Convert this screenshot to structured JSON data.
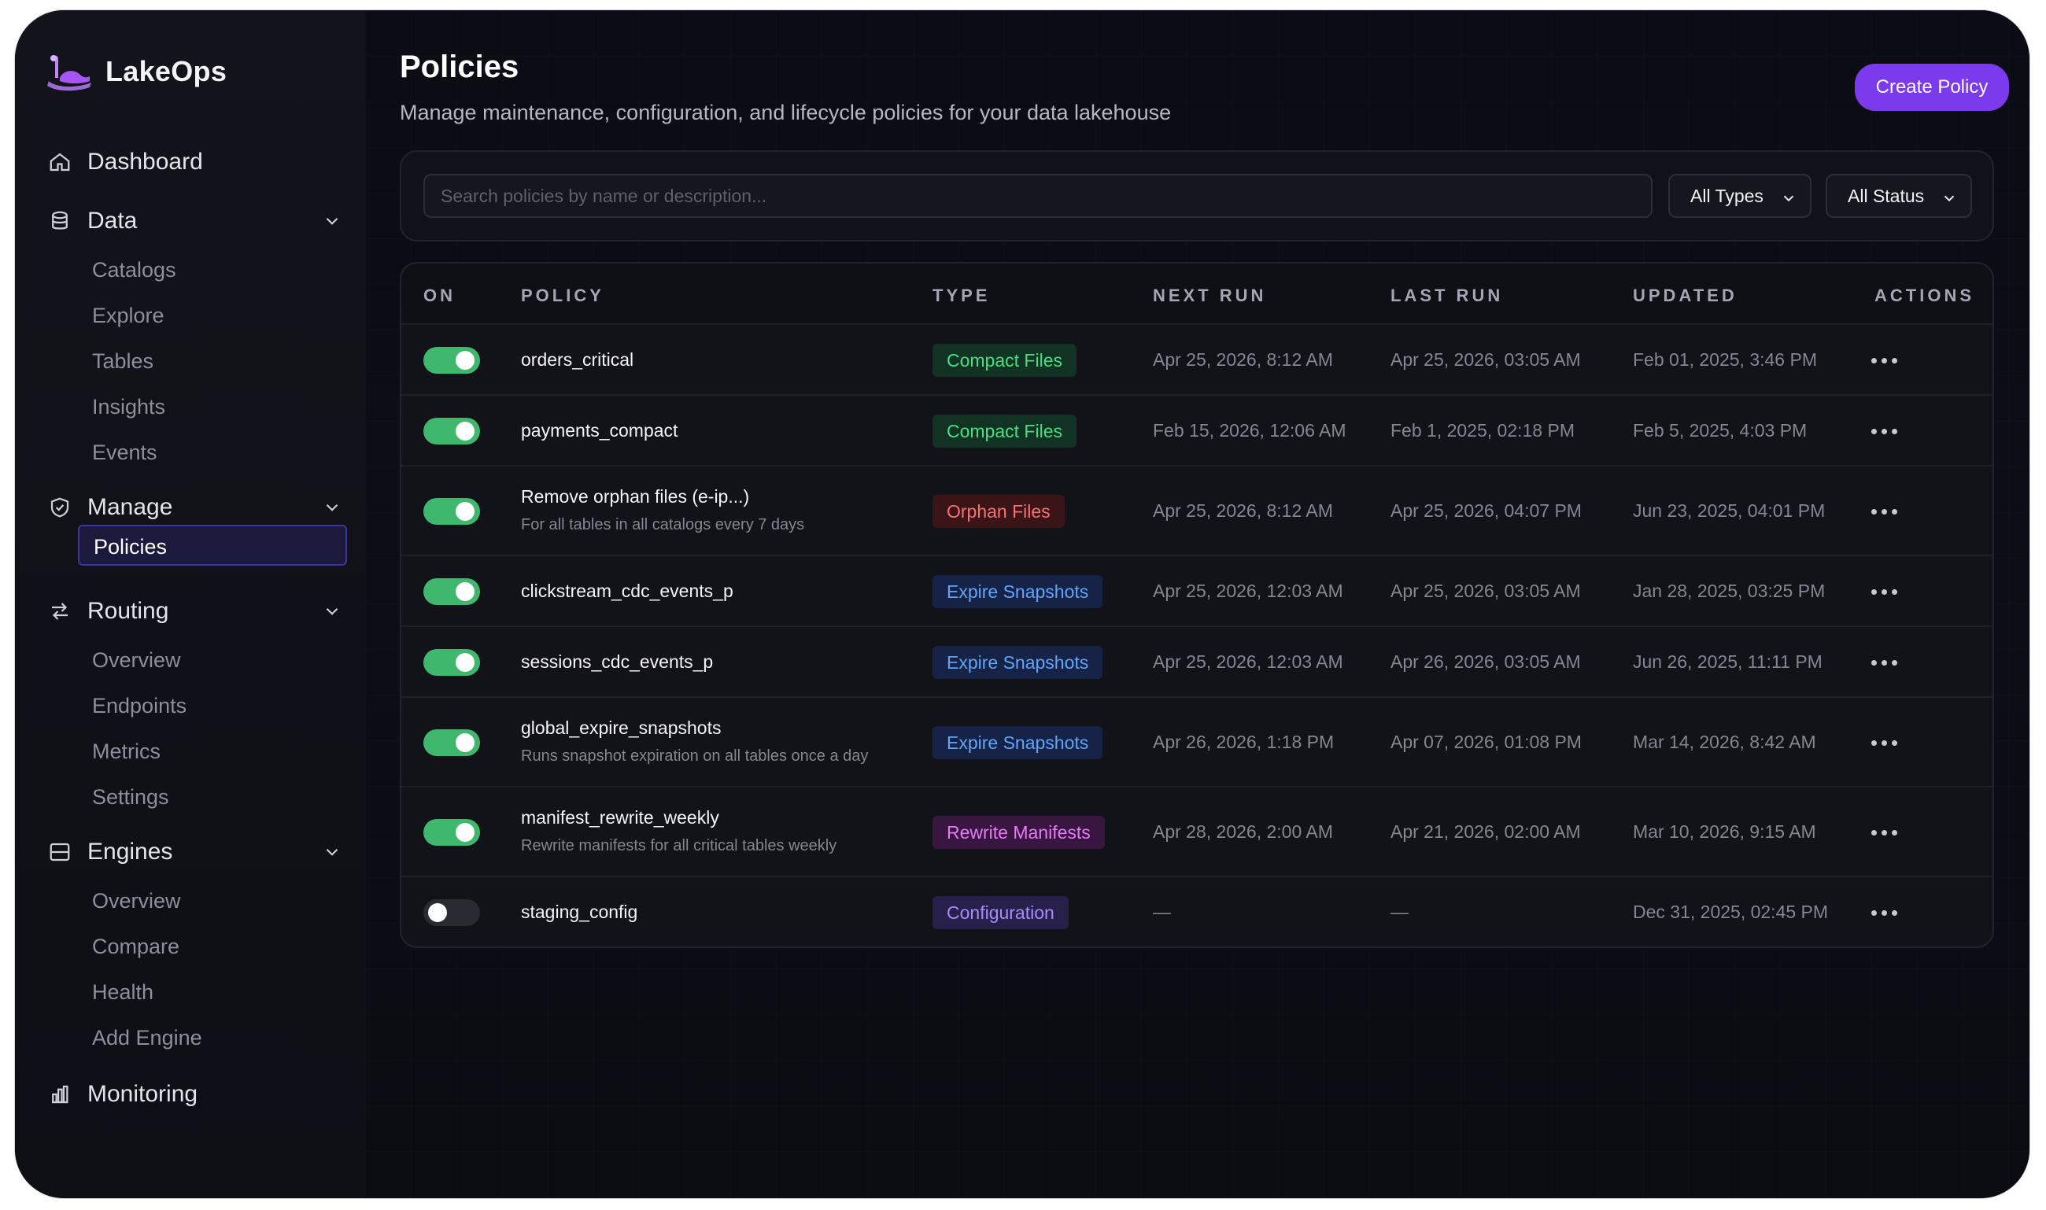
{
  "app": {
    "name": "LakeOps"
  },
  "sidebar": {
    "dashboard": {
      "label": "Dashboard"
    },
    "data": {
      "label": "Data",
      "items": [
        "Catalogs",
        "Explore",
        "Tables",
        "Insights",
        "Events"
      ]
    },
    "manage": {
      "label": "Manage",
      "items": [
        "Policies"
      ]
    },
    "routing": {
      "label": "Routing",
      "items": [
        "Overview",
        "Endpoints",
        "Metrics",
        "Settings"
      ]
    },
    "engines": {
      "label": "Engines",
      "items": [
        "Overview",
        "Compare",
        "Health",
        "Add Engine"
      ]
    },
    "monitoring": {
      "label": "Monitoring"
    },
    "active_item": "Policies"
  },
  "header": {
    "title": "Policies",
    "subtitle": "Manage maintenance, configuration, and lifecycle policies for your data lakehouse",
    "create_label": "Create Policy"
  },
  "filters": {
    "search_placeholder": "Search policies by name or description...",
    "type_select": "All Types",
    "status_select": "All Status"
  },
  "table": {
    "columns": [
      "ON",
      "POLICY",
      "TYPE",
      "NEXT RUN",
      "LAST RUN",
      "UPDATED",
      "ACTIONS"
    ],
    "rows": [
      {
        "on": true,
        "name": "orders_critical",
        "desc": "",
        "type": "Compact Files",
        "type_kind": "compact",
        "next_run": "Apr 25, 2026, 8:12 AM",
        "last_run": "Apr 25, 2026, 03:05 AM",
        "updated": "Feb 01, 2025, 3:46 PM"
      },
      {
        "on": true,
        "name": "payments_compact",
        "desc": "",
        "type": "Compact Files",
        "type_kind": "compact",
        "next_run": "Feb 15, 2026, 12:06 AM",
        "last_run": "Feb 1, 2025, 02:18 PM",
        "updated": "Feb 5, 2025, 4:03 PM"
      },
      {
        "on": true,
        "name": "Remove orphan files (e-ip...)",
        "desc": "For all tables in all catalogs every 7 days",
        "type": "Orphan Files",
        "type_kind": "orphan",
        "next_run": "Apr 25, 2026, 8:12 AM",
        "last_run": "Apr 25, 2026, 04:07 PM",
        "updated": "Jun 23, 2025, 04:01 PM"
      },
      {
        "on": true,
        "name": "clickstream_cdc_events_p",
        "desc": "",
        "type": "Expire Snapshots",
        "type_kind": "expire",
        "next_run": "Apr 25, 2026, 12:03 AM",
        "last_run": "Apr 25, 2026, 03:05 AM",
        "updated": "Jan 28, 2025, 03:25 PM"
      },
      {
        "on": true,
        "name": "sessions_cdc_events_p",
        "desc": "",
        "type": "Expire Snapshots",
        "type_kind": "expire",
        "next_run": "Apr 25, 2026, 12:03 AM",
        "last_run": "Apr 26, 2026, 03:05 AM",
        "updated": "Jun 26, 2025, 11:11 PM"
      },
      {
        "on": true,
        "name": "global_expire_snapshots",
        "desc": "Runs snapshot expiration on all tables once a day",
        "type": "Expire Snapshots",
        "type_kind": "expire",
        "next_run": "Apr 26, 2026, 1:18 PM",
        "last_run": "Apr 07, 2026, 01:08 PM",
        "updated": "Mar 14, 2026, 8:42 AM"
      },
      {
        "on": true,
        "name": "manifest_rewrite_weekly",
        "desc": "Rewrite manifests for all critical tables weekly",
        "type": "Rewrite Manifests",
        "type_kind": "rewrite",
        "next_run": "Apr 28, 2026, 2:00 AM",
        "last_run": "Apr 21, 2026, 02:00 AM",
        "updated": "Mar 10, 2026, 9:15 AM"
      },
      {
        "on": false,
        "name": "staging_config",
        "desc": "",
        "type": "Configuration",
        "type_kind": "config",
        "next_run": "—",
        "last_run": "—",
        "updated": "Dec 31, 2025, 02:45 PM"
      }
    ]
  },
  "colors": {
    "accent": "#7c3aed",
    "toggle_on": "#3fb86e",
    "badge_compact": "#4ade80",
    "badge_orphan": "#f87171",
    "badge_expire": "#60a5fa",
    "badge_rewrite": "#e879f9",
    "badge_config": "#a78bfa"
  }
}
